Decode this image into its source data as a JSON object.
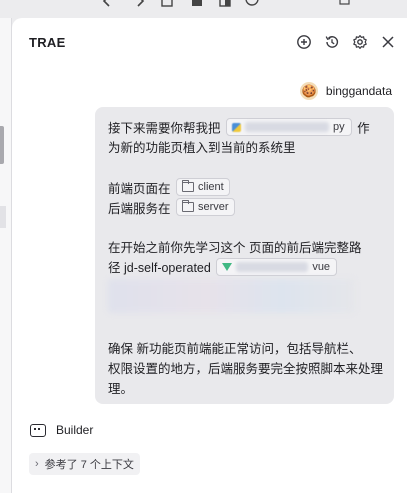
{
  "panel": {
    "title": "TRAE",
    "header_icons": [
      "new-chat-icon",
      "history-icon",
      "settings-icon",
      "close-icon"
    ]
  },
  "user": {
    "name": "binggandata",
    "avatar_icon": "cookie-avatar-icon"
  },
  "message": {
    "line1_prefix": "接下来需要你帮我把",
    "file_chip_ext": "py",
    "line1_suffix": "作",
    "line2": "为新的功能页植入到当前的系统里",
    "frontend_prefix": "前端页面在",
    "frontend_folder": "client",
    "backend_prefix": "后端服务在",
    "backend_folder": "server",
    "study_line1": "在开始之前你先学习这个 页面的前后端完整路",
    "study_line2_prefix": "径 jd-self-operated",
    "vue_chip_ext": "vue",
    "ensure_line1": "确保 新功能页前端能正常访问，包括导航栏、",
    "ensure_line2": "权限设置的地方，后端服务要完全按照脚本来处理",
    "ensure_line3": "理。"
  },
  "agent": {
    "name": "Builder",
    "icon": "builder-icon",
    "references_label": "参考了 7 个上下文"
  },
  "colors": {
    "panel_bg": "#ffffff",
    "bubble_bg": "#e9e9ec",
    "vue_green": "#41b883"
  }
}
